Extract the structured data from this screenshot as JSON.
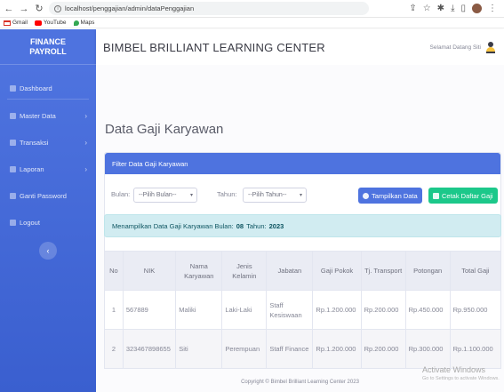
{
  "browser": {
    "url": "localhost/penggajian/admin/dataPenggajian",
    "bookmarks": [
      {
        "label": "Gmail",
        "color": "#d93025"
      },
      {
        "label": "YouTube",
        "color": "#ff0000"
      },
      {
        "label": "Maps",
        "color": "#34a853"
      }
    ]
  },
  "sidebar": {
    "brand_line1": "FINANCE",
    "brand_line2": "PAYROLL",
    "items": [
      {
        "label": "Dashboard",
        "has_chevron": false
      },
      {
        "label": "Master Data",
        "has_chevron": true
      },
      {
        "label": "Transaksi",
        "has_chevron": true
      },
      {
        "label": "Laporan",
        "has_chevron": true
      },
      {
        "label": "Ganti Password",
        "has_chevron": false
      },
      {
        "label": "Logout",
        "has_chevron": false
      }
    ],
    "toggle_glyph": "‹"
  },
  "topbar": {
    "title": "BIMBEL BRILLIANT LEARNING CENTER",
    "greeting": "Selamat Datang Siti"
  },
  "page": {
    "title": "Data Gaji Karyawan"
  },
  "filter": {
    "header": "Filter Data Gaji Karyawan",
    "bulan_label": "Bulan:",
    "bulan_value": "--Pilih Bulan--",
    "tahun_label": "Tahun:",
    "tahun_value": "--Pilih Tahun--",
    "show_button": "Tampilkan Data",
    "print_button": "Cetak Daftar Gaji"
  },
  "alert": {
    "prefix": "Menampilkan Data Gaji Karyawan Bulan:",
    "bulan": "08",
    "tahun_label": "Tahun:",
    "tahun": "2023"
  },
  "table": {
    "headers": [
      "No",
      "NIK",
      "Nama Karyawan",
      "Jenis Kelamin",
      "Jabatan",
      "Gaji Pokok",
      "Tj. Transport",
      "Potongan",
      "Total Gaji"
    ],
    "rows": [
      [
        "1",
        "567889",
        "Maliki",
        "Laki-Laki",
        "Staff Kesiswaan",
        "Rp.1.200.000",
        "Rp.200.000",
        "Rp.450.000",
        "Rp.950.000"
      ],
      [
        "2",
        "323467898655",
        "Siti",
        "Perempuan",
        "Staff Finance",
        "Rp.1.200.000",
        "Rp.200.000",
        "Rp.300.000",
        "Rp.1.100.000"
      ]
    ]
  },
  "footer": {
    "text": "Copyright © Bimbel Brilliant Learning Center 2023"
  },
  "watermark": {
    "title": "Activate Windows",
    "sub": "Go to Settings to activate Windows."
  },
  "colors": {
    "primary": "#4e73df",
    "success": "#1cc88a",
    "info_bg": "#d1ecf1"
  }
}
